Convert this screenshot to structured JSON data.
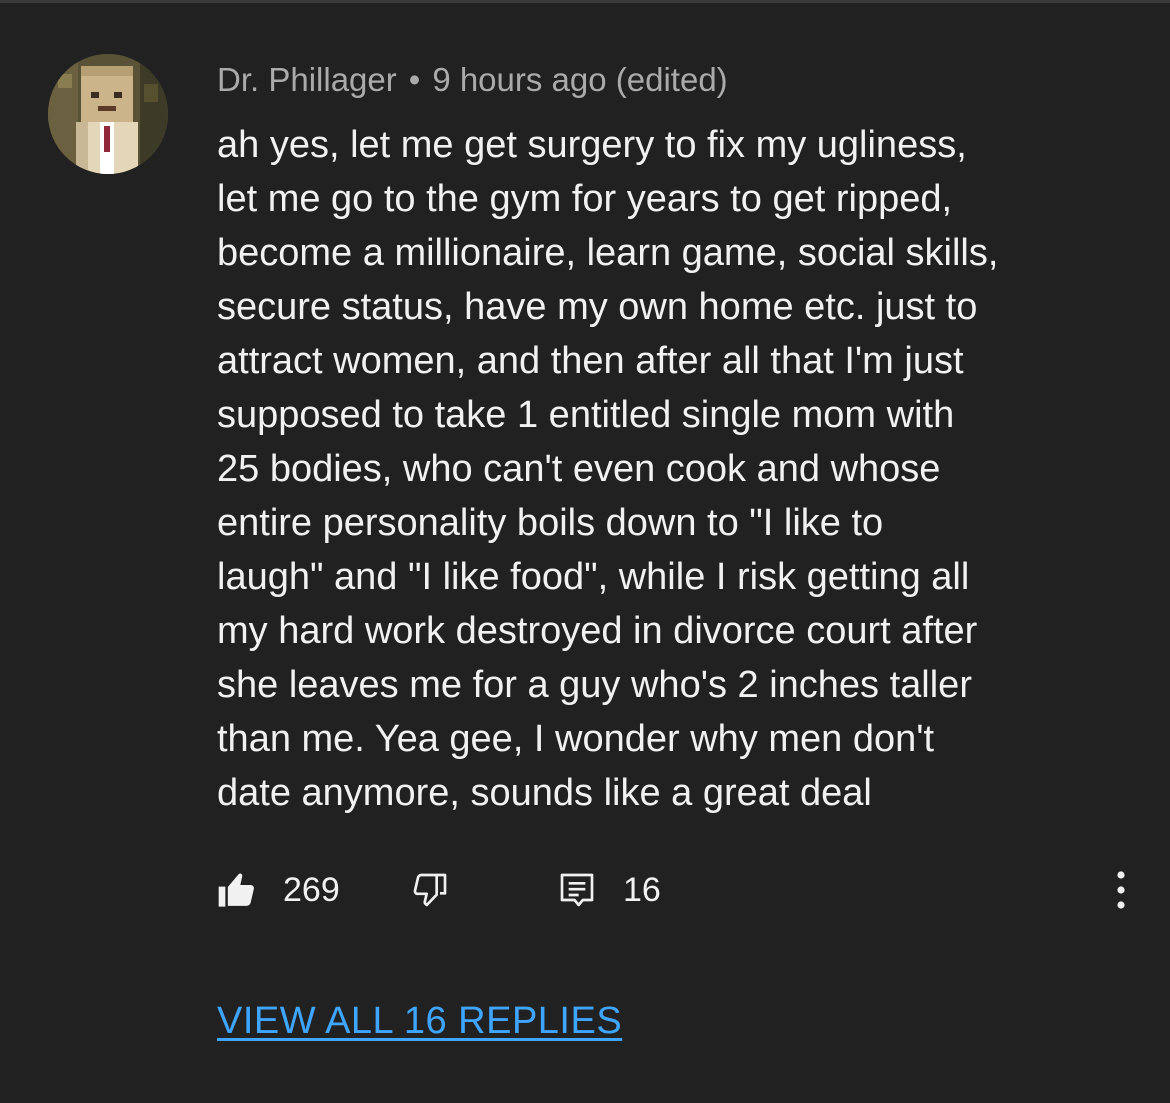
{
  "comment": {
    "author": "Dr. Phillager",
    "separator": "•",
    "timestamp": "9 hours ago (edited)",
    "body_lines": [
      "ah yes, let me get surgery to fix my ugliness,",
      "let me go to the gym for years to get ripped,",
      "become a millionaire, learn game, social skills,",
      "secure status, have my own home etc. just to",
      "attract women, and then after all that I'm just",
      "supposed to take 1 entitled single mom with",
      "25 bodies, who can't even cook and whose",
      "entire personality boils down to \"I like to",
      "laugh\" and \"I like food\", while I risk getting all",
      "my hard work destroyed in divorce court after",
      "she leaves me for a guy who's 2 inches taller",
      "than me. Yea gee, I wonder why men don't",
      "date anymore, sounds like a great deal"
    ],
    "actions": {
      "like_icon": "thumbs-up-filled-icon",
      "like_count": "269",
      "dislike_icon": "thumbs-down-outline-icon",
      "reply_icon": "comment-reply-icon",
      "reply_count": "16",
      "more_icon": "vertical-ellipsis-icon"
    },
    "view_replies_label": "VIEW ALL 16 REPLIES"
  },
  "colors": {
    "background": "#212121",
    "text_primary": "#f1f1f1",
    "text_secondary": "#aaaaaa",
    "link": "#3ea6ff"
  }
}
